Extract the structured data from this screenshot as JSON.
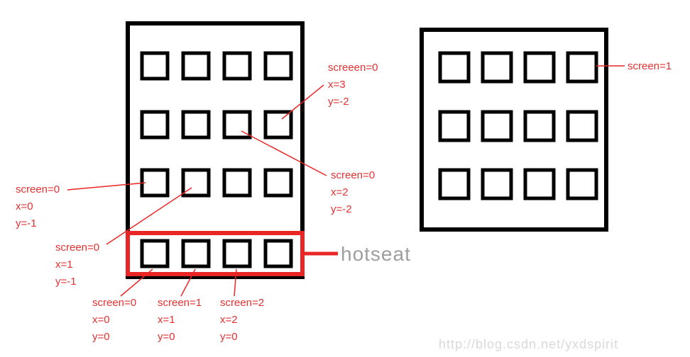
{
  "labels": {
    "left_top": [
      "screen=0",
      "x=0",
      "y=-1"
    ],
    "left_mid": [
      "screen=0",
      "x=1",
      "y=-1"
    ],
    "top_right_a": [
      "screeen=0",
      "x=3",
      "y=-2"
    ],
    "mid_right": [
      "screen=0",
      "x=2",
      "y=-2"
    ],
    "far_right": "screen=1",
    "hot_a": [
      "screen=0",
      "x=0",
      "y=0"
    ],
    "hot_b": [
      "screen=1",
      "x=1",
      "y=0"
    ],
    "hot_c": [
      "screen=2",
      "x=2",
      "y=0"
    ],
    "hotseat": "hotseat"
  },
  "watermark": "http://blog.csdn.net/yxdspirit",
  "chart_data": {
    "type": "diagram",
    "description": "Android launcher coordinate system showing two screens with 4-column icon grids and a shared hotseat row.",
    "screens": [
      {
        "index": 0,
        "rows": 3,
        "cols": 4
      },
      {
        "index": 1,
        "rows": 3,
        "cols": 4
      }
    ],
    "hotseat": {
      "cols": 4
    },
    "annotations": [
      {
        "target": "screen0 row -1 col 0",
        "screen": 0,
        "x": 0,
        "y": -1
      },
      {
        "target": "screen0 row -1 col 1",
        "screen": 0,
        "x": 1,
        "y": -1
      },
      {
        "target": "screen0 row -2 col 3",
        "screen": 0,
        "x": 3,
        "y": -2
      },
      {
        "target": "screen0 row -2 col 2",
        "screen": 0,
        "x": 2,
        "y": -2
      },
      {
        "target": "screen1",
        "screen": 1
      },
      {
        "target": "hotseat col 0",
        "screen": 0,
        "x": 0,
        "y": 0
      },
      {
        "target": "hotseat col 1",
        "screen": 1,
        "x": 1,
        "y": 0
      },
      {
        "target": "hotseat col 2",
        "screen": 2,
        "x": 2,
        "y": 0
      }
    ]
  }
}
